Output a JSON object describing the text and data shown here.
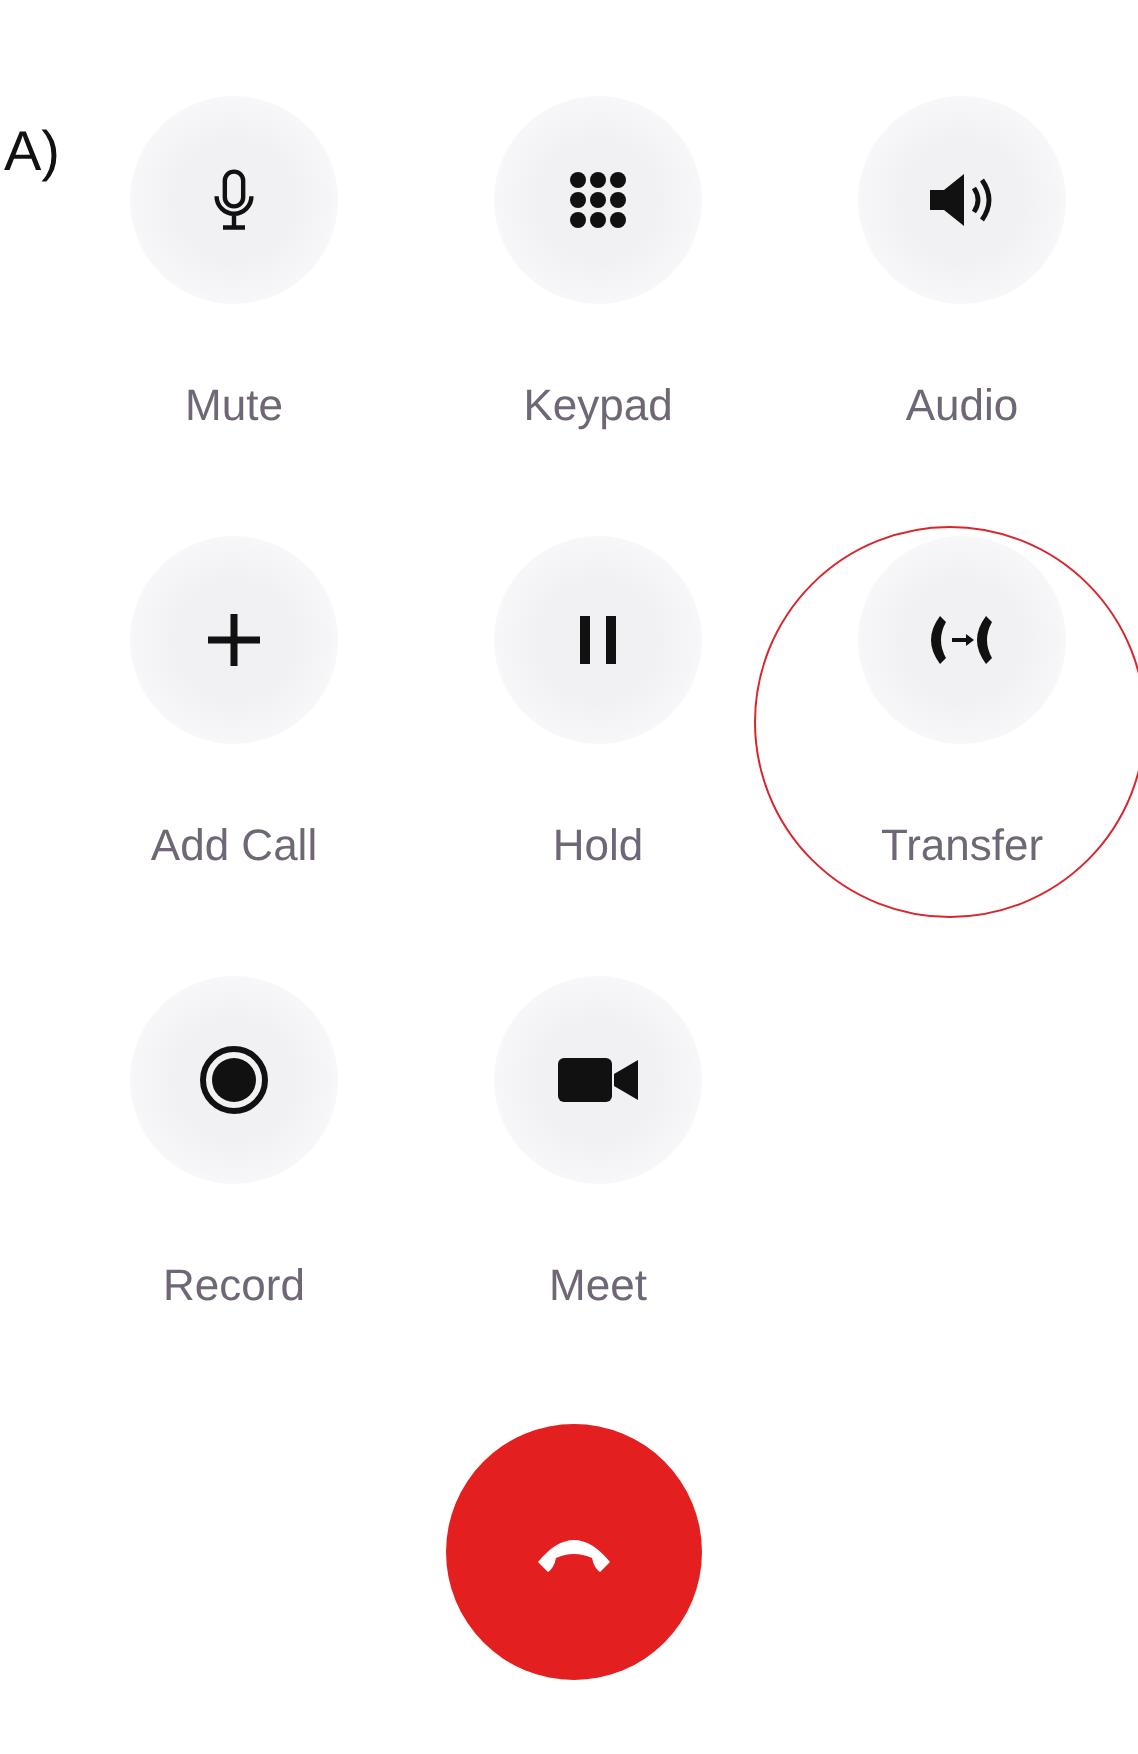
{
  "panel_label": "A)",
  "buttons": [
    {
      "label": "Mute",
      "kind": "mic",
      "annotated": false
    },
    {
      "label": "Keypad",
      "kind": "keypad",
      "annotated": false
    },
    {
      "label": "Audio",
      "kind": "speaker",
      "annotated": false
    },
    {
      "label": "Add Call",
      "kind": "plus",
      "annotated": false
    },
    {
      "label": "Hold",
      "kind": "pause",
      "annotated": false
    },
    {
      "label": "Transfer",
      "kind": "transfer",
      "annotated": true
    },
    {
      "label": "Record",
      "kind": "record",
      "annotated": false
    },
    {
      "label": "Meet",
      "kind": "video",
      "annotated": false
    }
  ],
  "end_call": {
    "kind": "hangup"
  }
}
